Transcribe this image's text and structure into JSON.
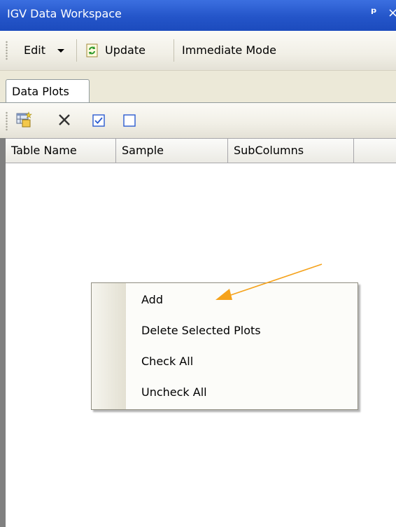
{
  "window": {
    "title": "IGV Data Workspace"
  },
  "titlebar": {
    "pin_glyph": "̧",
    "pin_label": "ᵩ",
    "close_label": "×"
  },
  "toolbar": {
    "edit_label": "Edit",
    "update_label": "Update",
    "immediate_mode_label": "Immediate Mode"
  },
  "tabs": [
    {
      "label": "Data Plots"
    }
  ],
  "icon_toolbar": {
    "icons": [
      "add-plot-icon",
      "delete-icon",
      "check-all-icon",
      "uncheck-all-icon"
    ]
  },
  "grid": {
    "columns": [
      {
        "label": "Table Name"
      },
      {
        "label": "Sample"
      },
      {
        "label": "SubColumns"
      },
      {
        "label": ""
      }
    ]
  },
  "context_menu": {
    "items": [
      {
        "label": "Add"
      },
      {
        "label": "Delete Selected Plots"
      },
      {
        "label": "Check All"
      },
      {
        "label": "Uncheck All"
      }
    ]
  },
  "colors": {
    "titlebar": "#2455c9",
    "annotation_arrow": "#f5a21b"
  }
}
